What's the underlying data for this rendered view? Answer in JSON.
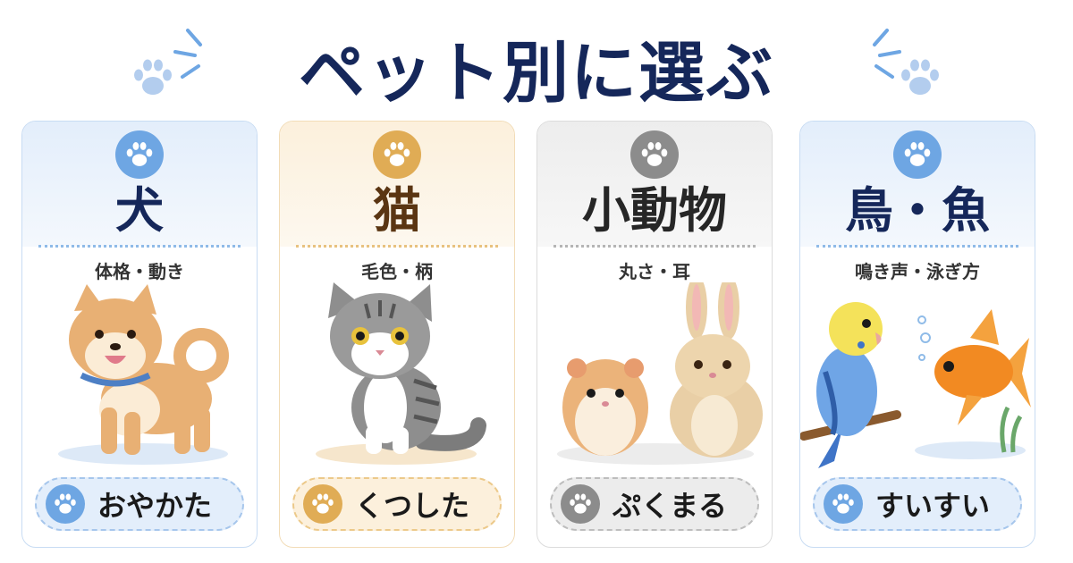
{
  "header": {
    "title": "ペット別に選ぶ",
    "left_icon": "paw-icon",
    "right_icon": "paw-icon"
  },
  "colors": {
    "title": "#15275a",
    "blue": "#6ea6e3",
    "orange": "#e0ac55",
    "gray": "#8c8c8c"
  },
  "cards": [
    {
      "title": "犬",
      "feature": "体格・動き",
      "name": "おやかた",
      "icon": "paw-icon",
      "illustration": "shiba-dog-illustration",
      "theme": "blue"
    },
    {
      "title": "猫",
      "feature": "毛色・柄",
      "name": "くつした",
      "icon": "paw-icon",
      "illustration": "tabby-cat-illustration",
      "theme": "orange"
    },
    {
      "title": "小動物",
      "feature": "丸さ・耳",
      "name": "ぷくまる",
      "icon": "paw-icon",
      "illustration": "hamster-rabbit-illustration",
      "theme": "gray"
    },
    {
      "title": "鳥・魚",
      "feature": "鳴き声・泳ぎ方",
      "name": "すいすい",
      "icon": "paw-icon",
      "illustration": "budgie-goldfish-illustration",
      "theme": "blue"
    }
  ]
}
